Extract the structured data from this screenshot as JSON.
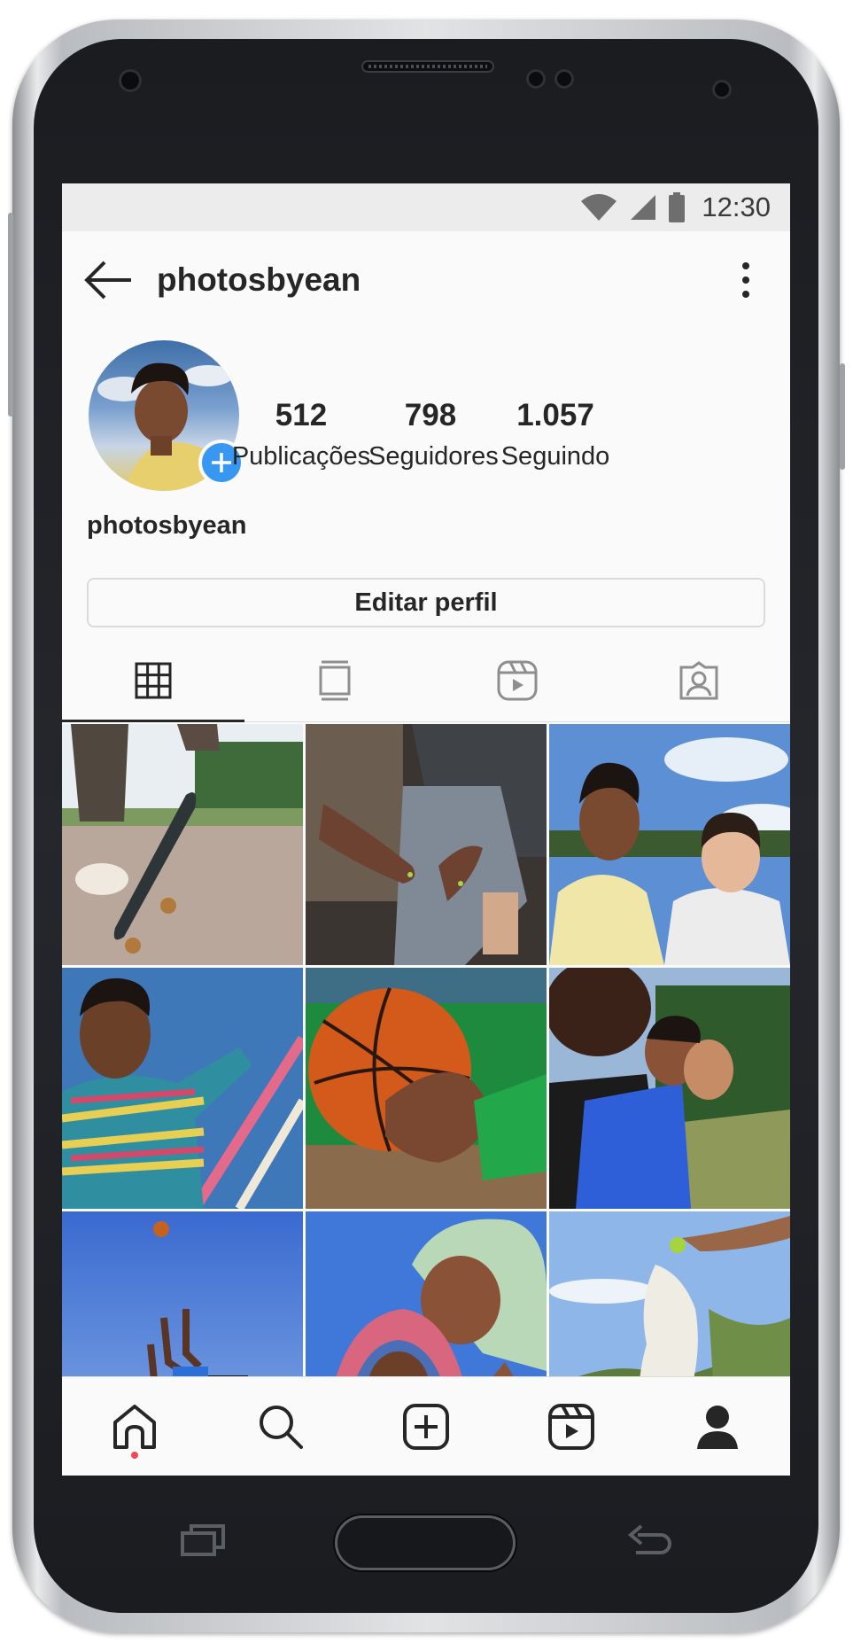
{
  "status_bar": {
    "time": "12:30"
  },
  "header": {
    "title": "photosbyean"
  },
  "profile": {
    "display_name": "photosbyean",
    "stats": [
      {
        "value": "512",
        "label": "Publicações"
      },
      {
        "value": "798",
        "label": "Seguidores"
      },
      {
        "value": "1.057",
        "label": "Seguindo"
      }
    ],
    "edit_button_label": "Editar perfil"
  },
  "tabs": [
    {
      "icon": "grid-icon",
      "active": true
    },
    {
      "icon": "igtv-icon",
      "active": false
    },
    {
      "icon": "reels-icon",
      "active": false
    },
    {
      "icon": "tagged-icon",
      "active": false
    }
  ],
  "grid_posts": [
    {
      "subject": "skateboard-photo"
    },
    {
      "subject": "hands-on-legs-photo"
    },
    {
      "subject": "two-friends-sky-photo"
    },
    {
      "subject": "striped-sweater-photo"
    },
    {
      "subject": "basketball-photo"
    },
    {
      "subject": "group-selfie-photo"
    },
    {
      "subject": "basketball-jump-photo"
    },
    {
      "subject": "towel-selfie-photo"
    },
    {
      "subject": "dog-ball-photo"
    }
  ],
  "bottom_nav": [
    {
      "icon": "home-icon",
      "has_notification": true
    },
    {
      "icon": "search-icon"
    },
    {
      "icon": "new-post-icon"
    },
    {
      "icon": "reels-icon"
    },
    {
      "icon": "profile-icon"
    }
  ],
  "colors": {
    "accent": "#3897f0",
    "notification": "#ed4956",
    "text": "#262626"
  }
}
